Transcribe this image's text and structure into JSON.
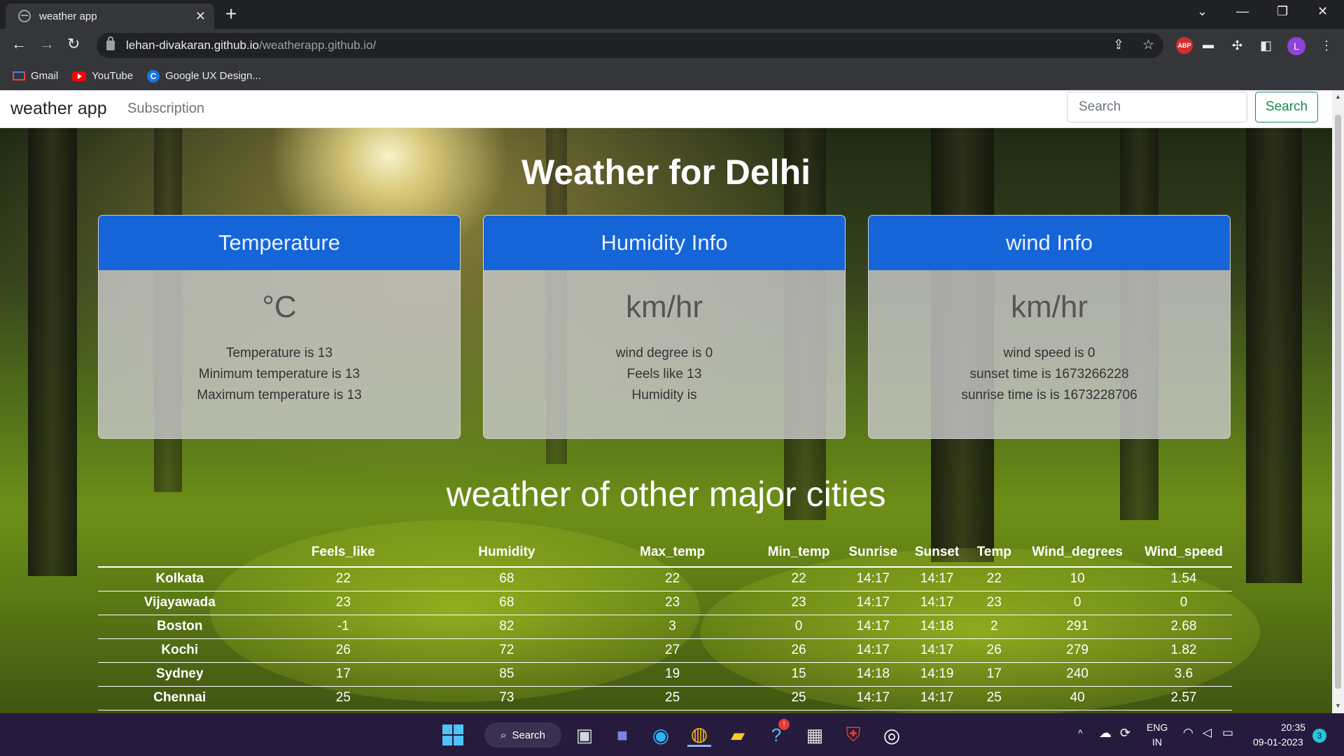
{
  "browser": {
    "tab_title": "weather app",
    "tab_close": "✕",
    "new_tab": "+",
    "url_host": "lehan-divakaran.github.io",
    "url_path": "/weatherapp.github.io/",
    "avatar_letter": "L",
    "abp_label": "ABP",
    "bookmarks": [
      {
        "label": "Gmail"
      },
      {
        "label": "YouTube"
      },
      {
        "label": "Google UX Design..."
      }
    ]
  },
  "navbar": {
    "brand": "weather app",
    "link": "Subscription",
    "search_placeholder": "Search",
    "search_button": "Search"
  },
  "main": {
    "title": "Weather for Delhi",
    "cards": [
      {
        "header": "Temperature",
        "big": "°C",
        "lines": [
          "Temperature is 13",
          "Minimum temperature is 13",
          "Maximum temperature is 13"
        ]
      },
      {
        "header": "Humidity Info",
        "big": "km/hr",
        "lines": [
          "wind degree is 0",
          "Feels like 13",
          "Humidity is"
        ]
      },
      {
        "header": "wind Info",
        "big": "km/hr",
        "lines": [
          "wind speed is 0",
          "sunset time is 1673266228",
          "sunrise time is is 1673228706"
        ]
      }
    ],
    "subtitle": "weather of other major cities"
  },
  "table": {
    "headers": [
      "",
      "Feels_like",
      "Humidity",
      "Max_temp",
      "Min_temp",
      "Sunrise",
      "Sunset",
      "Temp",
      "Wind_degrees",
      "Wind_speed"
    ],
    "rows": [
      [
        "Kolkata",
        "22",
        "68",
        "22",
        "22",
        "14:17",
        "14:17",
        "22",
        "10",
        "1.54"
      ],
      [
        "Vijayawada",
        "23",
        "68",
        "23",
        "23",
        "14:17",
        "14:17",
        "23",
        "0",
        "0"
      ],
      [
        "Boston",
        "-1",
        "82",
        "3",
        "0",
        "14:17",
        "14:18",
        "2",
        "291",
        "2.68"
      ],
      [
        "Kochi",
        "26",
        "72",
        "27",
        "26",
        "14:17",
        "14:17",
        "26",
        "279",
        "1.82"
      ],
      [
        "Sydney",
        "17",
        "85",
        "19",
        "15",
        "14:18",
        "14:19",
        "17",
        "240",
        "3.6"
      ],
      [
        "Chennai",
        "25",
        "73",
        "25",
        "25",
        "14:17",
        "14:17",
        "25",
        "40",
        "2.57"
      ]
    ]
  },
  "taskbar": {
    "search_label": "Search",
    "lang_top": "ENG",
    "lang_bottom": "IN",
    "time": "20:35",
    "date": "09-01-2023",
    "notification_count": "3",
    "help_badge": "!"
  },
  "colors": {
    "card_header": "#1565d8",
    "search_button": "#198754",
    "chrome_dark": "#202124",
    "taskbar": "#271b3d"
  }
}
